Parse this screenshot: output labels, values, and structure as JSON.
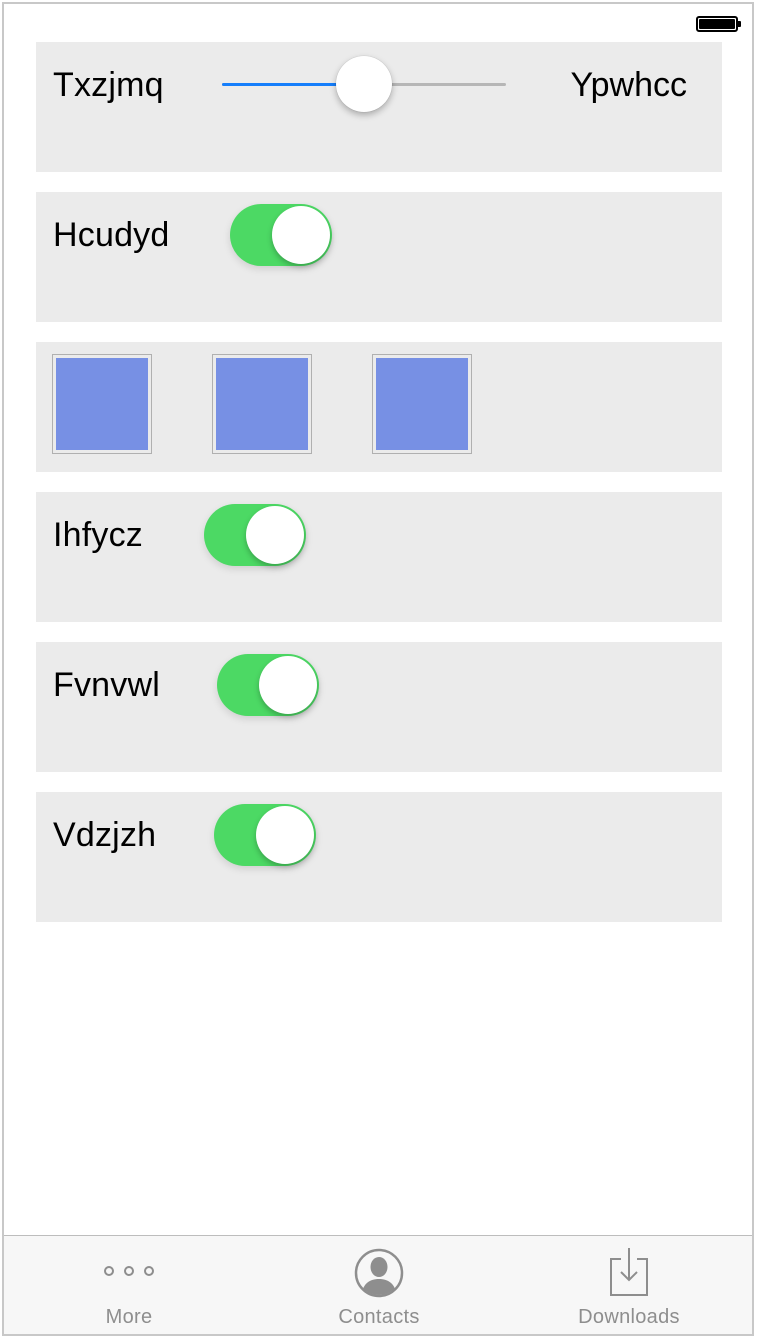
{
  "slider_row": {
    "label_left": "Txzjmq",
    "label_right": "Ypwhcc",
    "value": 0.5,
    "accent_color": "#157efb"
  },
  "toggle_rows": [
    {
      "label": "Hcudyd",
      "on": true
    },
    {
      "label": "Ihfycz",
      "on": true
    },
    {
      "label": "Fvnvwl",
      "on": true
    },
    {
      "label": "Vdzjzh",
      "on": true
    }
  ],
  "square_row": {
    "count": 3,
    "color": "#7790e4"
  },
  "colors": {
    "toggle_on": "#4cd964",
    "row_background": "#ebebeb"
  },
  "tabbar": {
    "items": [
      {
        "label": "More",
        "icon": "more-icon"
      },
      {
        "label": "Contacts",
        "icon": "contacts-icon"
      },
      {
        "label": "Downloads",
        "icon": "downloads-icon"
      }
    ]
  }
}
